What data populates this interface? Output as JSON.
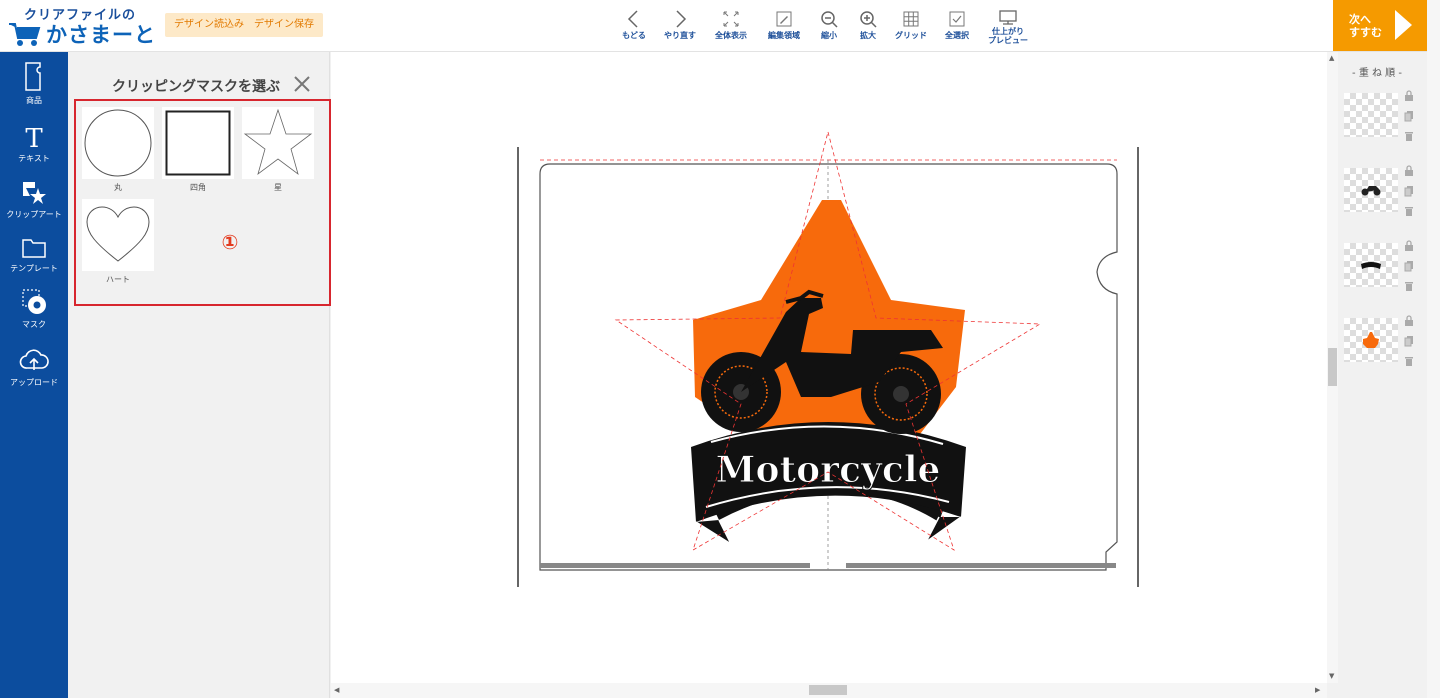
{
  "header": {
    "logo_top": "クリアファイルの",
    "logo_main": "かさまーと",
    "load_design": "デザイン読込み",
    "save_design": "デザイン保存",
    "tools": [
      {
        "icon": "chevron-left-icon",
        "label": "もどる"
      },
      {
        "icon": "chevron-right-icon",
        "label": "やり直す"
      },
      {
        "icon": "fit-screen-icon",
        "label": "全体表示"
      },
      {
        "icon": "edit-area-icon",
        "label": "編集領域"
      },
      {
        "icon": "zoom-out-icon",
        "label": "縮小"
      },
      {
        "icon": "zoom-in-icon",
        "label": "拡大"
      },
      {
        "icon": "grid-icon",
        "label": "グリッド"
      },
      {
        "icon": "select-all-icon",
        "label": "全選択"
      },
      {
        "icon": "monitor-icon",
        "label_line1": "仕上がり",
        "label_line2": "プレビュー"
      }
    ],
    "next_line1": "次へ",
    "next_line2": "すすむ"
  },
  "leftnav": {
    "items": [
      {
        "icon": "product-icon",
        "label": "商品"
      },
      {
        "icon": "text-icon",
        "label": "テキスト"
      },
      {
        "icon": "clipart-icon",
        "label": "クリップアート"
      },
      {
        "icon": "template-icon",
        "label": "テンプレート"
      },
      {
        "icon": "mask-icon",
        "label": "マスク"
      },
      {
        "icon": "upload-icon",
        "label": "アップロード"
      }
    ]
  },
  "mask_panel": {
    "title": "クリッピングマスクを選ぶ",
    "items": [
      {
        "shape": "circle",
        "label": "丸"
      },
      {
        "shape": "square",
        "label": "四角"
      },
      {
        "shape": "star",
        "label": "星"
      },
      {
        "shape": "heart",
        "label": "ハート"
      }
    ],
    "annotation": "①"
  },
  "canvas": {
    "design_text": "Motorcycle",
    "accent_color": "#f76a0c"
  },
  "layers": {
    "title": "- 重 ね 順 -",
    "items": [
      {
        "content": "blank"
      },
      {
        "content": "motorcycle"
      },
      {
        "content": "banner"
      },
      {
        "content": "orange-star"
      }
    ]
  },
  "colors": {
    "nav_blue": "#0c4d9e",
    "next_orange": "#f59a00",
    "highlight_red": "#d7262e"
  }
}
